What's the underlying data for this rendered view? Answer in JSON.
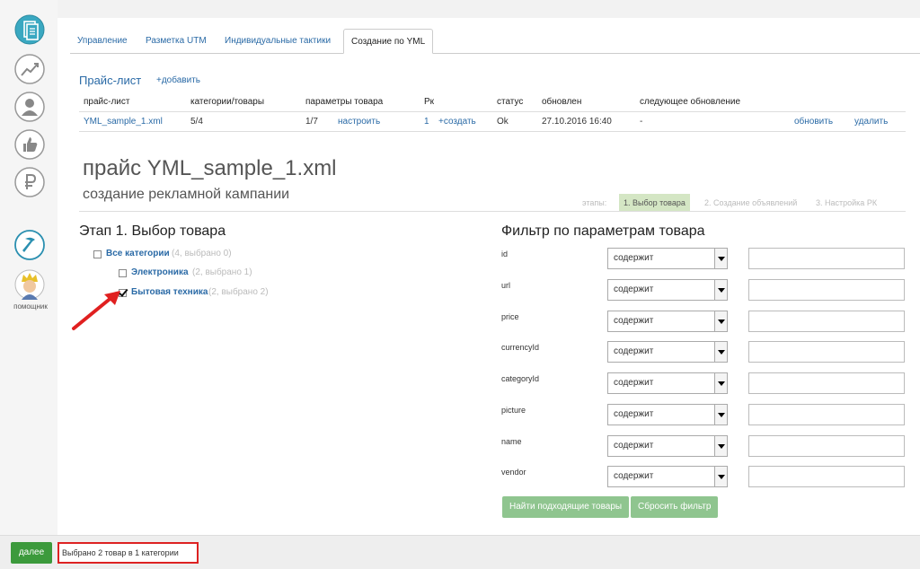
{
  "tabs": [
    "Управление",
    "Разметка UTM",
    "Индивидуальные тактики",
    "Создание по YML"
  ],
  "pricelist": {
    "header": "Прайс-лист",
    "add_label": "+добавить",
    "columns": [
      "прайс-лист",
      "категории/товары",
      "параметры товара",
      "Рк",
      "статус",
      "обновлен",
      "следующее обновление"
    ],
    "row": {
      "file": "YML_sample_1.xml",
      "categories": "5/4",
      "params": "1/7",
      "configure": "настроить",
      "rk": "1",
      "create": "+создать",
      "status": "Ok",
      "updated": "27.10.2016 16:40",
      "next_update": "-",
      "refresh": "обновить",
      "delete": "удалить"
    }
  },
  "title": "прайс YML_sample_1.xml",
  "subtitle": "создание рекламной кампании",
  "stages": {
    "label": "этапы:",
    "items": [
      "1. Выбор товара",
      "2. Создание объявлений",
      "3. Настройка РК"
    ]
  },
  "step1": {
    "title": "Этап 1. Выбор товара",
    "categories": [
      {
        "name": "Все категории",
        "count": "(4, выбрано 0)",
        "checked": false
      },
      {
        "name": "Электроника",
        "count": "(2, выбрано 1)",
        "checked": false
      },
      {
        "name": "Бытовая техника",
        "count": "(2, выбрано 2)",
        "checked": true
      }
    ]
  },
  "filter": {
    "title": "Фильтр по параметрам товара",
    "select_value": "содержит",
    "fields": [
      "id",
      "url",
      "price",
      "currencyId",
      "categoryId",
      "picture",
      "name",
      "vendor"
    ],
    "find_button": "Найти подходящие товары",
    "reset_button": "Сбросить фильтр"
  },
  "sidebar": {
    "assistant_label": "помощник"
  },
  "footer": {
    "next_button": "далее",
    "selected_text": "Выбрано 2 товар в 1 категории"
  },
  "colors": {
    "accent": "#2a6aa6",
    "green": "#3c9a3c",
    "light_green": "#8fc58f",
    "red": "#d22"
  }
}
